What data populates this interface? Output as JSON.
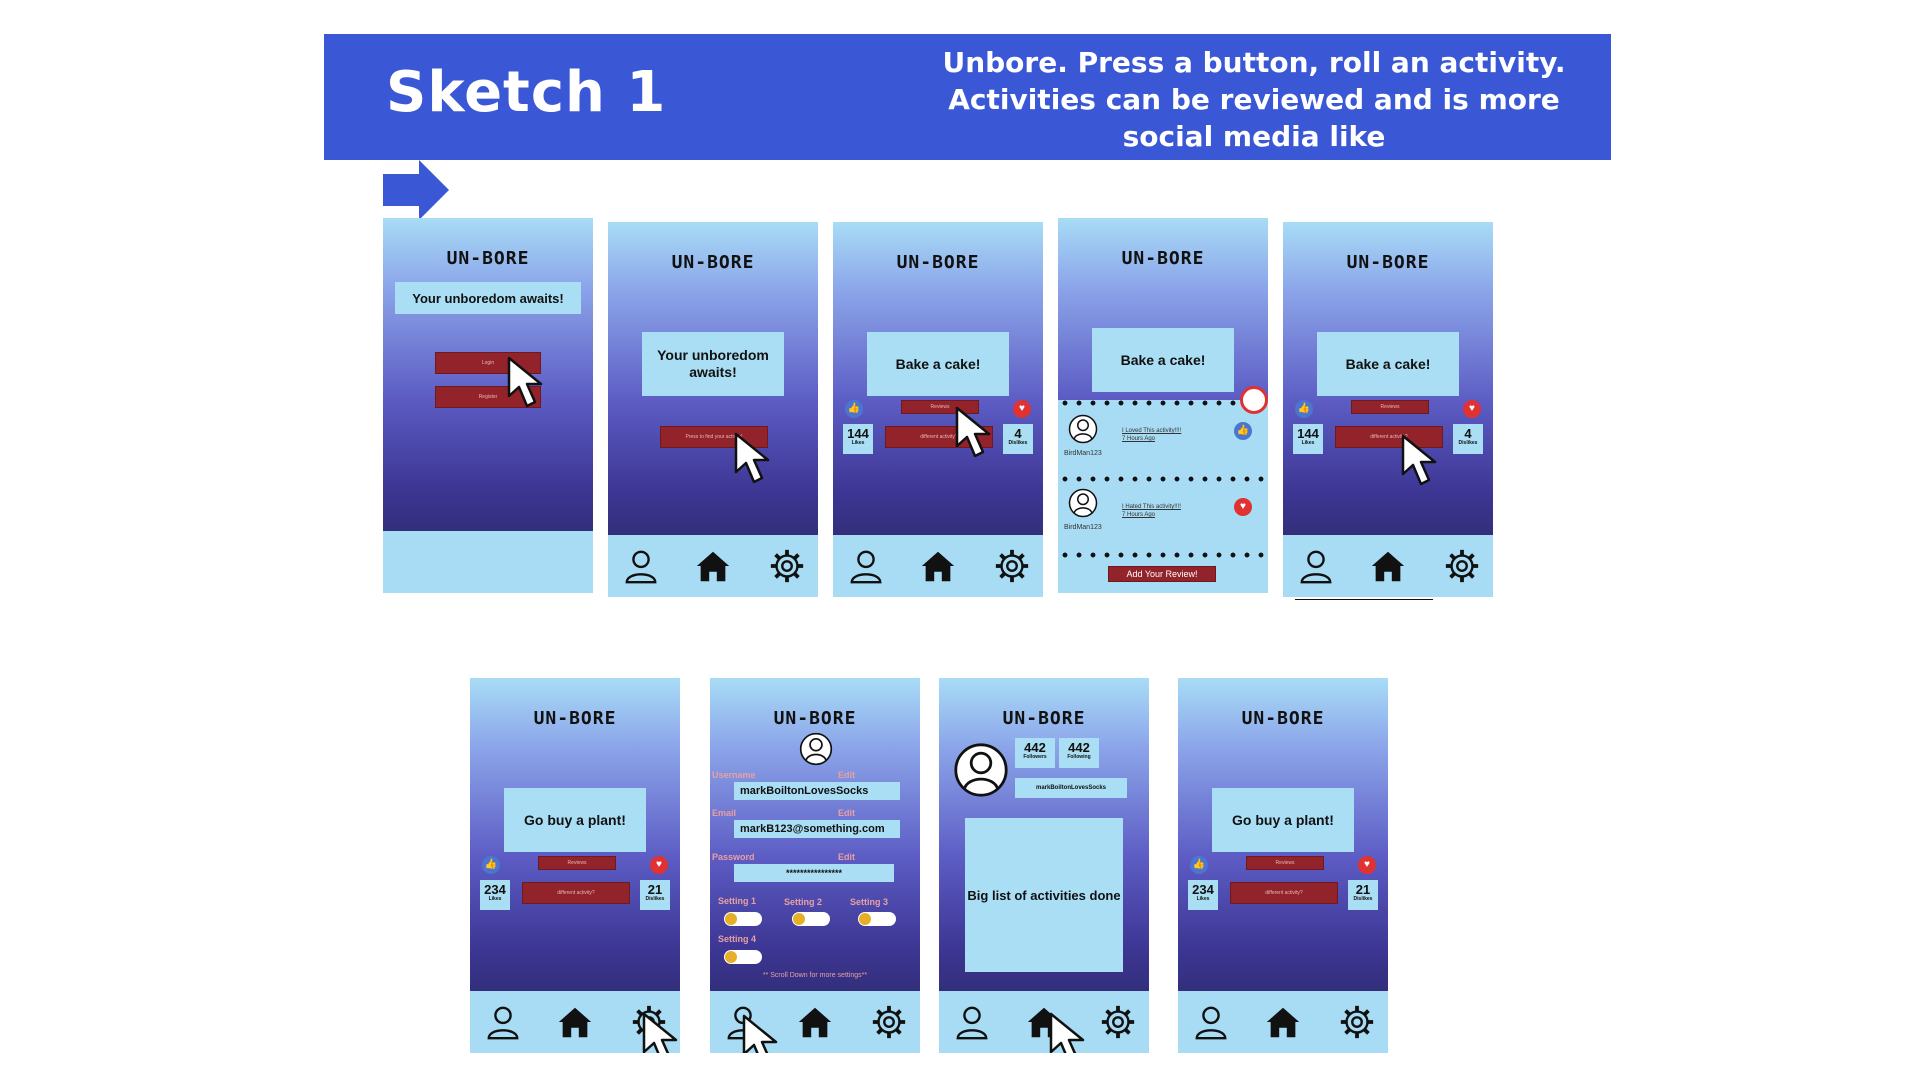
{
  "header": {
    "title": "Sketch 1",
    "description": "Unbore. Press a button, roll an activity. Activities can be reviewed and is more social media like"
  },
  "app_name": "UN-BORE",
  "screens": {
    "s1": {
      "prompt": "Your unboredom awaits!",
      "login": "Login",
      "register": "Register"
    },
    "s2": {
      "prompt": "Your unboredom awaits!",
      "button": "Press to find your activity!"
    },
    "s3": {
      "activity": "Bake a cake!",
      "review": "Reviews",
      "different": "different activity?",
      "likes": "144",
      "likes_label": "Likes",
      "dislikes": "4",
      "dislikes_label": "Dislikes"
    },
    "s4": {
      "activity": "Bake a cake!",
      "reviews": [
        {
          "user": "BirdMan123",
          "text": "I Loved This activity!!!!",
          "time": "7 Hours Ago"
        },
        {
          "user": "BirdMan123",
          "text": "I Hated This activity!!!!",
          "time": "7 Hours Ago"
        }
      ],
      "add_review": "Add Your Review!"
    },
    "s5": {
      "activity": "Bake a cake!",
      "review": "Reviews",
      "different": "different activity?",
      "likes": "144",
      "likes_label": "Likes",
      "dislikes": "4",
      "dislikes_label": "Dislikes"
    },
    "s6": {
      "activity": "Go buy a plant!",
      "review": "Reviews",
      "different": "different activity?",
      "likes": "234",
      "likes_label": "Likes",
      "dislikes": "21",
      "dislikes_label": "Dislikes"
    },
    "s7": {
      "edit": "Edit",
      "username_label": "Username",
      "username": "markBoiltonLovesSocks",
      "email_label": "Email",
      "email": "markB123@something.com",
      "password_label": "Password",
      "password": "****************",
      "settings": [
        "Setting 1",
        "Setting 2",
        "Setting 3",
        "Setting 4"
      ],
      "scroll_hint": "** Scroll Down for more settings**"
    },
    "s8": {
      "followers": "442",
      "followers_label": "Followers",
      "following": "442",
      "following_label": "Following",
      "username": "markBoiltonLovesSocks",
      "activities": "Big list of activities done"
    },
    "s9": {
      "activity": "Go buy a plant!",
      "review": "Reviews",
      "different": "different activity?",
      "likes": "234",
      "likes_label": "Likes",
      "dislikes": "21",
      "dislikes_label": "Dislikes"
    }
  }
}
